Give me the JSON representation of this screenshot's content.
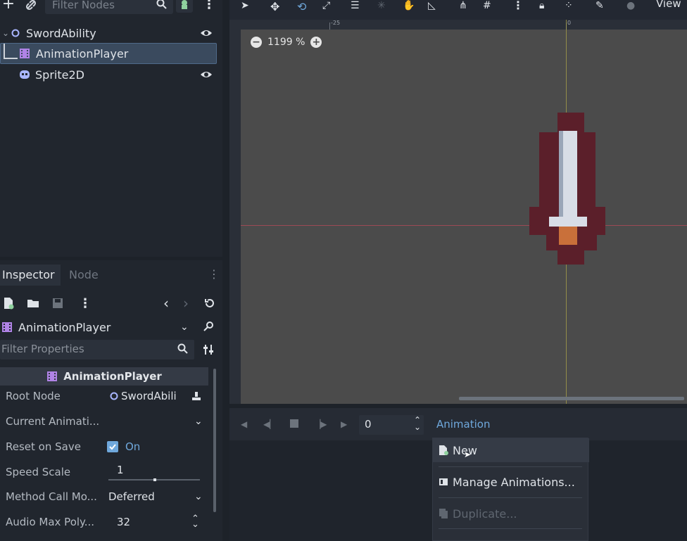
{
  "scene": {
    "filter_placeholder": "Filter Nodes",
    "nodes": [
      {
        "label": "SwordAbility"
      },
      {
        "label": "AnimationPlayer"
      },
      {
        "label": "Sprite2D"
      }
    ]
  },
  "inspector": {
    "tab_inspector": "Inspector",
    "tab_node": "Node",
    "object_name": "AnimationPlayer",
    "filter_placeholder": "Filter Properties",
    "section_title": "AnimationPlayer",
    "properties": [
      {
        "label": "Root Node",
        "value": "SwordAbili"
      },
      {
        "label": "Current Animati...",
        "value": ""
      },
      {
        "label": "Reset on Save",
        "value": "On"
      },
      {
        "label": "Speed Scale",
        "value": "1"
      },
      {
        "label": "Method Call Mo...",
        "value": "Deferred"
      },
      {
        "label": "Audio Max Poly...",
        "value": "32"
      }
    ]
  },
  "viewport": {
    "view_label": "View",
    "zoom": "1199 %",
    "ruler_neg": "-25",
    "ruler_zero": "0"
  },
  "animation": {
    "time_value": "0",
    "menu_title": "Animation",
    "menu_items": [
      "New",
      "Manage Animations...",
      "Duplicate..."
    ]
  },
  "colors": {
    "accent": "#6fa8dc",
    "selected_row": "#3a4a5e",
    "sword_outline": "#5b1f2a",
    "sword_blade": "#d8dde6",
    "sword_hilt": "#c9703a"
  }
}
